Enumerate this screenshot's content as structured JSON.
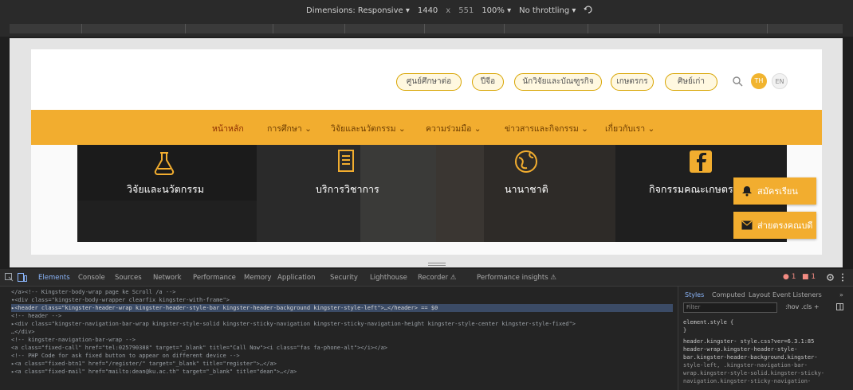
{
  "device_toolbar": {
    "dimensions_label": "Dimensions: Responsive ▾",
    "width": "1440",
    "times": "x",
    "height": "551",
    "zoom": "100% ▾",
    "throttling": "No throttling ▾"
  },
  "site": {
    "top_links": [
      "ศูนย์ศึกษาต่อ",
      "ปีจีอ",
      "นักวิจัยและบัณฑูรกิจ",
      "เกษตรกร",
      "ศิษย์เก่า"
    ],
    "lang_th": "TH",
    "lang_en": "EN",
    "nav": [
      "หน้าหลัก",
      "การศึกษา ⌄",
      "วิจัยและนวัตกรรม ⌄",
      "ความร่วมมือ ⌄",
      "ข่าวสารและกิจกรรม ⌄",
      "เกี่ยวกับเรา ⌄"
    ],
    "tiles": [
      "วิจัยและนวัตกรรม",
      "บริการวิชาการ",
      "นานาชาติ",
      "กิจกรรมคณะเกษตร"
    ],
    "float_register": "สมัครเรียน",
    "float_contact": "ส่ายตรงคณบดี"
  },
  "colors": {
    "accent": "#f2ad2f",
    "nav_text": "#6b3b00",
    "tile_bg": "#1c1c1c"
  },
  "devtools": {
    "tabs": [
      "Elements",
      "Console",
      "Sources",
      "Network",
      "Performance",
      "Memory",
      "Application",
      "Security",
      "Lighthouse",
      "Recorder ⚠",
      "Performance insights ⚠"
    ],
    "errors": "● 1",
    "warnings": "■ 1",
    "code_lines": [
      "</a><!-- Kingster-body-wrap page ke Scroll  /a -->",
      "▾<div class=\"kingster-body-wrapper clearfix  kingster-with-frame\">",
      "▸<header class=\"kingster-header-wrap kingster-header-style-bar kingster-header-background  kingster-style-left\">…</header> == $0",
      "  <!-- header -->",
      "▸<div class=\"kingster-navigation-bar-wrap  kingster-style-solid kingster-sticky-navigation kingster-sticky-navigation-height kingster-style-center  kingster-style-fixed\">",
      "  …</div>",
      "  <!-- kingster-navigation-bar-wrap -->",
      "  <a class=\"fixed-call\" href=\"tel:025790388\" target=\"_blank\" title=\"Call Now\"><i class=\"fas fa-phone-alt\"></i></a>",
      "  <!-- PHP Code for ask fixed button to appear on different device -->",
      "▸<a class=\"fixed-btn1\" href=\"/register/\" target=\"_blank\" title=\"register\">…</a>",
      "▸<a class=\"fixed-mail\" href=\"mailto:dean@ku.ac.th\" target=\"_blank\" title=\"dean\">…</a>"
    ],
    "styles_tabs": [
      "Styles",
      "Computed",
      "Layout",
      "Event Listeners",
      "»"
    ],
    "filter_placeholder": "Filter",
    "styles_controls": ":hov  .cls  +",
    "styles_lines": [
      "element.style {",
      "}",
      "header.kingster-        style.css?ver=6.3.1:85",
      "header-wrap.kingster-header-style-",
      "bar.kingster-header-background.kingster-",
      "style-left, .kingster-navigation-bar-",
      "wrap.kingster-style-solid.kingster-sticky-",
      "navigation.kingster-sticky-navigation-"
    ]
  }
}
